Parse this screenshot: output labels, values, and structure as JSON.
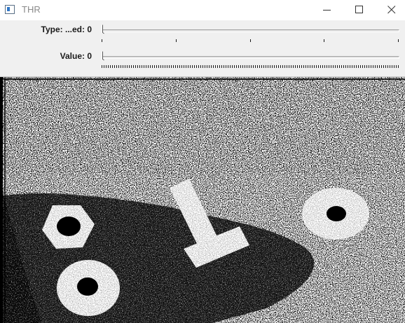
{
  "window": {
    "title": "THR",
    "icon": "app-window-icon",
    "buttons": [
      "minimize-icon",
      "maximize-icon",
      "close-icon"
    ]
  },
  "trackbars": [
    {
      "label": "Type: ...ed: 0",
      "value": 0,
      "max": 4,
      "ticks": 5
    },
    {
      "label": "Value: 0",
      "value": 0,
      "max": 255
    }
  ],
  "image": {
    "content": "binary threshold output of washer, nut and bolt on noisy background",
    "colors": {
      "foreground": "#ffffff",
      "background": "#000000"
    }
  },
  "colors": {
    "chrome": "#f0f0f0",
    "titlebar": "#ffffff",
    "title_text": "#8a8a8a"
  }
}
